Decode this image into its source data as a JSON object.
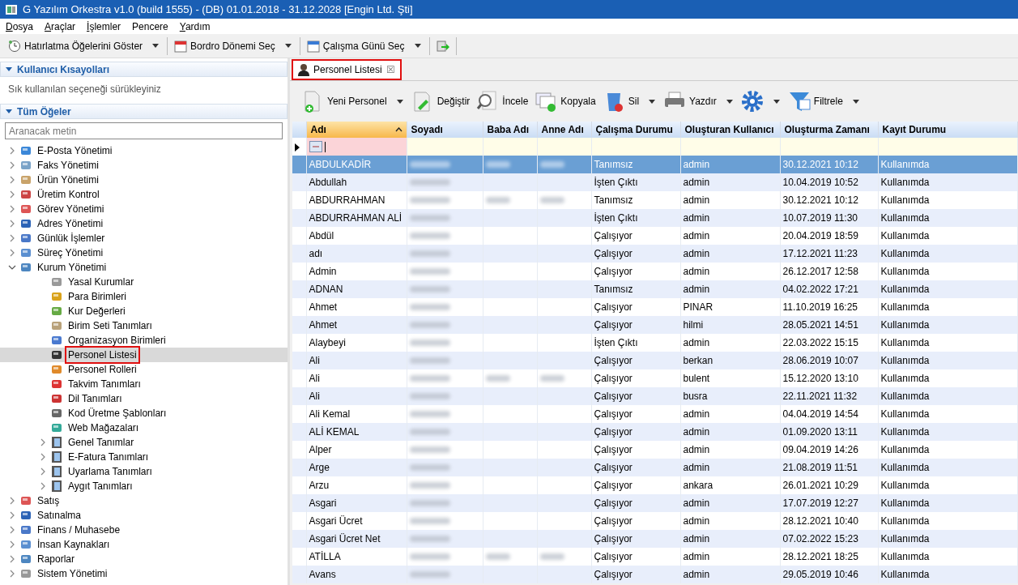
{
  "window": {
    "title": "G Yazılım Orkestra v1.0 (build 1555) - (DB) 01.01.2018 - 31.12.2028 [Engin Ltd. Şti]"
  },
  "menu": [
    {
      "label": "Dosya",
      "underlined": true
    },
    {
      "label": "Araçlar",
      "underlined": true
    },
    {
      "label": "İşlemler",
      "underlined": true
    },
    {
      "label": "Pencere",
      "underlined": false
    },
    {
      "label": "Yardım",
      "underlined": true
    }
  ],
  "toolbar": [
    {
      "label": "Hatırlatma Öğelerini Göster",
      "dropdown": true
    },
    {
      "label": "Bordro Dönemi Seç",
      "dropdown": true
    },
    {
      "label": "Çalışma Günü Seç",
      "dropdown": true
    },
    {
      "dropdown": false
    }
  ],
  "sidebar": {
    "shortcuts": {
      "title": "Kullanıcı Kısayolları",
      "hint": "Sık kullanılan seçeneği sürükleyiniz"
    },
    "all_items": {
      "title": "Tüm Öğeler",
      "search": {
        "placeholder": "Aranacak metin"
      },
      "items": [
        {
          "label": "E-Posta Yönetimi",
          "kind": "group",
          "expanded": false,
          "selected": false
        },
        {
          "label": "Faks Yönetimi",
          "kind": "group",
          "expanded": false,
          "selected": false
        },
        {
          "label": "Ürün Yönetimi",
          "kind": "group",
          "expanded": false,
          "selected": false
        },
        {
          "label": "Üretim Kontrol",
          "kind": "group",
          "expanded": false,
          "selected": false
        },
        {
          "label": "Görev Yönetimi",
          "kind": "group",
          "expanded": false,
          "selected": false
        },
        {
          "label": "Adres Yönetimi",
          "kind": "group",
          "expanded": false,
          "selected": false
        },
        {
          "label": "Günlük İşlemler",
          "kind": "group",
          "expanded": false,
          "selected": false
        },
        {
          "label": "Süreç Yönetimi",
          "kind": "group",
          "expanded": false,
          "selected": false
        },
        {
          "label": "Kurum Yönetimi",
          "kind": "group",
          "expanded": true,
          "selected": false,
          "children": [
            {
              "label": "Yasal Kurumlar",
              "kind": "leaf",
              "selected": false
            },
            {
              "label": "Para Birimleri",
              "kind": "leaf",
              "selected": false
            },
            {
              "label": "Kur Değerleri",
              "kind": "leaf",
              "selected": false
            },
            {
              "label": "Birim Seti Tanımları",
              "kind": "leaf",
              "selected": false
            },
            {
              "label": "Organizasyon Birimleri",
              "kind": "leaf",
              "selected": false
            },
            {
              "label": "Personel Listesi",
              "kind": "leaf",
              "selected": true,
              "highlighted": true
            },
            {
              "label": "Personel Rolleri",
              "kind": "leaf",
              "selected": false
            },
            {
              "label": "Takvim Tanımları",
              "kind": "leaf",
              "selected": false
            },
            {
              "label": "Dil Tanımları",
              "kind": "leaf",
              "selected": false
            },
            {
              "label": "Kod Üretme Şablonları",
              "kind": "leaf",
              "selected": false
            },
            {
              "label": "Web Mağazaları",
              "kind": "leaf",
              "selected": false
            },
            {
              "label": "Genel Tanımlar",
              "kind": "group",
              "expanded": false,
              "selected": false
            },
            {
              "label": "E-Fatura Tanımları",
              "kind": "group",
              "expanded": false,
              "selected": false
            },
            {
              "label": "Uyarlama Tanımları",
              "kind": "group",
              "expanded": false,
              "selected": false
            },
            {
              "label": "Aygıt Tanımları",
              "kind": "group",
              "expanded": false,
              "selected": false
            }
          ]
        },
        {
          "label": "Satış",
          "kind": "group",
          "expanded": false,
          "selected": false
        },
        {
          "label": "Satınalma",
          "kind": "group",
          "expanded": false,
          "selected": false
        },
        {
          "label": "Finans / Muhasebe",
          "kind": "group",
          "expanded": false,
          "selected": false
        },
        {
          "label": "İnsan Kaynakları",
          "kind": "group",
          "expanded": false,
          "selected": false
        },
        {
          "label": "Raporlar",
          "kind": "group",
          "expanded": false,
          "selected": false
        },
        {
          "label": "Sistem Yönetimi",
          "kind": "group",
          "expanded": false,
          "selected": false
        }
      ]
    }
  },
  "tabs": [
    {
      "label": "Personel Listesi",
      "selected": true,
      "highlighted": true,
      "close": "☒"
    }
  ],
  "grid_toolbar": [
    {
      "label": "Yeni Personel",
      "dropdown": true
    },
    {
      "label": "Değiştir",
      "dropdown": false
    },
    {
      "label": "İncele",
      "dropdown": false
    },
    {
      "label": "Kopyala",
      "dropdown": false
    },
    {
      "label": "Sil",
      "dropdown": true
    },
    {
      "label": "Yazdır",
      "dropdown": true
    },
    {
      "dropdown": true
    },
    {
      "label": "Filtrele",
      "dropdown": true
    }
  ],
  "table": {
    "columns": [
      {
        "label": "Adı",
        "sorted": true
      },
      {
        "label": "Soyadı",
        "sorted": false
      },
      {
        "label": "Baba Adı",
        "sorted": false
      },
      {
        "label": "Anne Adı",
        "sorted": false
      },
      {
        "label": "Çalışma Durumu",
        "sorted": false
      },
      {
        "label": "Oluşturan Kullanıcı",
        "sorted": false
      },
      {
        "label": "Oluşturma Zamanı",
        "sorted": false
      },
      {
        "label": "Kayıt Durumu",
        "sorted": false
      }
    ],
    "rows": [
      {
        "selected": true,
        "name": "ABDULKADİR",
        "blurred": [
          true,
          true,
          true
        ],
        "status": "Tanımsız",
        "created_by": "admin",
        "created_at": "30.12.2021 10:12",
        "record_state": "Kullanımda"
      },
      {
        "selected": false,
        "name": "Abdullah",
        "blurred": [
          true,
          false,
          false
        ],
        "status": "İşten Çıktı",
        "created_by": "admin",
        "created_at": "10.04.2019 10:52",
        "record_state": "Kullanımda"
      },
      {
        "selected": false,
        "name": "ABDURRAHMAN",
        "blurred": [
          true,
          true,
          true
        ],
        "status": "Tanımsız",
        "created_by": "admin",
        "created_at": "30.12.2021 10:12",
        "record_state": "Kullanımda"
      },
      {
        "selected": false,
        "name": "ABDURRAHMAN ALİ",
        "blurred": [
          true,
          false,
          false
        ],
        "status": "İşten Çıktı",
        "created_by": "admin",
        "created_at": "10.07.2019 11:30",
        "record_state": "Kullanımda"
      },
      {
        "selected": false,
        "name": "Abdül",
        "blurred": [
          true,
          false,
          false
        ],
        "status": "Çalışıyor",
        "created_by": "admin",
        "created_at": "20.04.2019 18:59",
        "record_state": "Kullanımda"
      },
      {
        "selected": false,
        "name": "adı",
        "blurred": [
          true,
          false,
          false
        ],
        "status": "Çalışıyor",
        "created_by": "admin",
        "created_at": "17.12.2021 11:23",
        "record_state": "Kullanımda"
      },
      {
        "selected": false,
        "name": "Admin",
        "blurred": [
          true,
          false,
          false
        ],
        "status": "Çalışıyor",
        "created_by": "admin",
        "created_at": "26.12.2017 12:58",
        "record_state": "Kullanımda"
      },
      {
        "selected": false,
        "name": "ADNAN",
        "blurred": [
          true,
          false,
          false
        ],
        "status": "Tanımsız",
        "created_by": "admin",
        "created_at": "04.02.2022 17:21",
        "record_state": "Kullanımda"
      },
      {
        "selected": false,
        "name": "Ahmet",
        "blurred": [
          true,
          false,
          false
        ],
        "status": "Çalışıyor",
        "created_by": "PINAR",
        "created_at": "11.10.2019 16:25",
        "record_state": "Kullanımda"
      },
      {
        "selected": false,
        "name": "Ahmet",
        "blurred": [
          true,
          false,
          false
        ],
        "status": "Çalışıyor",
        "created_by": "hilmi",
        "created_at": "28.05.2021 14:51",
        "record_state": "Kullanımda"
      },
      {
        "selected": false,
        "name": "Alaybeyi",
        "blurred": [
          true,
          false,
          false
        ],
        "status": "İşten Çıktı",
        "created_by": "admin",
        "created_at": "22.03.2022 15:15",
        "record_state": "Kullanımda"
      },
      {
        "selected": false,
        "name": "Ali",
        "blurred": [
          true,
          false,
          false
        ],
        "status": "Çalışıyor",
        "created_by": "berkan",
        "created_at": "28.06.2019 10:07",
        "record_state": "Kullanımda"
      },
      {
        "selected": false,
        "name": "Ali",
        "blurred": [
          true,
          true,
          true
        ],
        "status": "Çalışıyor",
        "created_by": "bulent",
        "created_at": "15.12.2020 13:10",
        "record_state": "Kullanımda"
      },
      {
        "selected": false,
        "name": "Ali",
        "blurred": [
          true,
          false,
          false
        ],
        "status": "Çalışıyor",
        "created_by": "busra",
        "created_at": "22.11.2021 11:32",
        "record_state": "Kullanımda"
      },
      {
        "selected": false,
        "name": "Ali Kemal",
        "blurred": [
          true,
          false,
          false
        ],
        "status": "Çalışıyor",
        "created_by": "admin",
        "created_at": "04.04.2019 14:54",
        "record_state": "Kullanımda"
      },
      {
        "selected": false,
        "name": "ALİ KEMAL",
        "blurred": [
          true,
          false,
          false
        ],
        "status": "Çalışıyor",
        "created_by": "admin",
        "created_at": "01.09.2020 13:11",
        "record_state": "Kullanımda"
      },
      {
        "selected": false,
        "name": "Alper",
        "blurred": [
          true,
          false,
          false
        ],
        "status": "Çalışıyor",
        "created_by": "admin",
        "created_at": "09.04.2019 14:26",
        "record_state": "Kullanımda"
      },
      {
        "selected": false,
        "name": "Arge",
        "blurred": [
          true,
          false,
          false
        ],
        "status": "Çalışıyor",
        "created_by": "admin",
        "created_at": "21.08.2019 11:51",
        "record_state": "Kullanımda"
      },
      {
        "selected": false,
        "name": "Arzu",
        "blurred": [
          true,
          false,
          false
        ],
        "status": "Çalışıyor",
        "created_by": "ankara",
        "created_at": "26.01.2021 10:29",
        "record_state": "Kullanımda"
      },
      {
        "selected": false,
        "name": "Asgari",
        "blurred": [
          true,
          false,
          false
        ],
        "status": "Çalışıyor",
        "created_by": "admin",
        "created_at": "17.07.2019 12:27",
        "record_state": "Kullanımda"
      },
      {
        "selected": false,
        "name": "Asgari Ücret",
        "blurred": [
          true,
          false,
          false
        ],
        "status": "Çalışıyor",
        "created_by": "admin",
        "created_at": "28.12.2021 10:40",
        "record_state": "Kullanımda"
      },
      {
        "selected": false,
        "name": "Asgari Ücret Net",
        "blurred": [
          true,
          false,
          false
        ],
        "status": "Çalışıyor",
        "created_by": "admin",
        "created_at": "07.02.2022 15:23",
        "record_state": "Kullanımda"
      },
      {
        "selected": false,
        "name": "ATİLLA",
        "blurred": [
          true,
          true,
          true
        ],
        "status": "Çalışıyor",
        "created_by": "admin",
        "created_at": "28.12.2021 18:25",
        "record_state": "Kullanımda"
      },
      {
        "selected": false,
        "name": "Avans",
        "blurred": [
          true,
          false,
          false
        ],
        "status": "Çalışıyor",
        "created_by": "admin",
        "created_at": "29.05.2019 10:46",
        "record_state": "Kullanımda"
      }
    ]
  }
}
